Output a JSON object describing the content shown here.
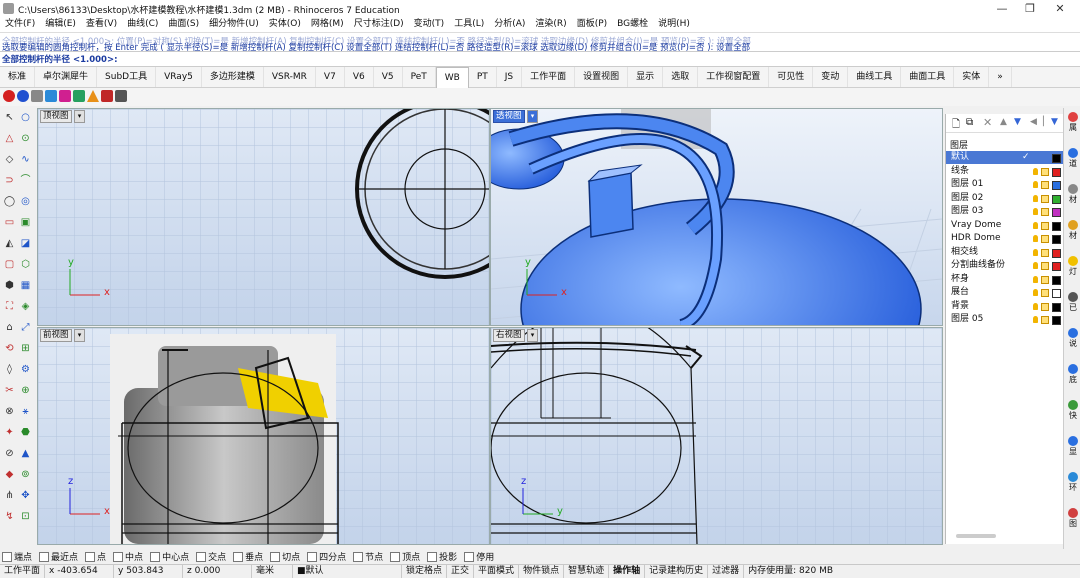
{
  "window": {
    "title": "C:\\Users\\86133\\Desktop\\水杯建模教程\\水杯建模1.3dm (2 MB) - Rhinoceros 7 Education",
    "minimize": "—",
    "maximize": "❐",
    "close": "✕"
  },
  "menu": [
    "文件(F)",
    "编辑(E)",
    "查看(V)",
    "曲线(C)",
    "曲面(S)",
    "细分物件(U)",
    "实体(O)",
    "网格(M)",
    "尺寸标注(D)",
    "变动(T)",
    "工具(L)",
    "分析(A)",
    "渲染(R)",
    "面板(P)",
    "BG螺栓",
    "说明(H)"
  ],
  "command": {
    "history_faded": "全部控制杆的半径 <1.000>: 位置(P)=对称(S) 切换(T)=是 新增控制杆(A) 复制控制杆(C) 设置全部(T) 连结控制杆(L)=否 路径造型(R)=滚球 选取边缘(D) 修剪并组合(I)=是 预览(P)=否 ): 设置全部",
    "history": "选取要编辑的圆角控制杆，按 Enter 完成 ( 显示半径(S)=是  新增控制杆(A)  复制控制杆(C)  设置全部(T)  连结控制杆(L)=否  路径造型(R)=滚球  选取边缘(D)  修剪并组合(I)=是  预览(P)=否 ): 设置全部",
    "prompt": "全部控制杆的半径 <1.000>:"
  },
  "tabs": [
    "标准",
    "卓尔渊犀牛",
    "SubD工具",
    "VRay5",
    "多边形建模",
    "VSR-MR",
    "V7",
    "V6",
    "V5",
    "PeT",
    "WB",
    "PT",
    "JS",
    "工作平面",
    "设置视图",
    "显示",
    "选取",
    "工作视窗配置",
    "可见性",
    "变动",
    "曲线工具",
    "曲面工具",
    "实体"
  ],
  "active_tab": "WB",
  "tab_overflow": "»",
  "viewports": {
    "top": {
      "label": "顶视图",
      "x_axis": "x",
      "y_axis": "y"
    },
    "perspective": {
      "label": "透视图",
      "x_axis": "x",
      "y_axis": "y"
    },
    "front": {
      "label": "前视图",
      "x_axis": "x",
      "z_axis": "z"
    },
    "right": {
      "label": "右视图",
      "x_axis": "y",
      "z_axis": "z"
    }
  },
  "layers": {
    "header": "图层",
    "rows": [
      {
        "name": "默认",
        "selected": true,
        "check": "✓",
        "color": "#000000"
      },
      {
        "name": "线条",
        "color": "#e02020"
      },
      {
        "name": "图层 01",
        "color": "#2a6fe0"
      },
      {
        "name": "图层 02",
        "color": "#30b030"
      },
      {
        "name": "图层 03",
        "color": "#c030c0"
      },
      {
        "name": "Vray Dome",
        "color": "#000000"
      },
      {
        "name": "HDR Dome",
        "color": "#000000"
      },
      {
        "name": "相交线",
        "color": "#e02020"
      },
      {
        "name": "分割曲线备份",
        "color": "#e02020"
      },
      {
        "name": "杯身",
        "color": "#000000"
      },
      {
        "name": "展台",
        "color": "#ffffff"
      },
      {
        "name": "背景",
        "color": "#000000"
      },
      {
        "name": "图层 05",
        "color": "#000000"
      }
    ]
  },
  "right_dock": [
    "属",
    "道",
    "材",
    "材",
    "灯",
    "已",
    "说",
    "底",
    "快",
    "显",
    "环",
    "图"
  ],
  "osnaps": [
    "端点",
    "最近点",
    "点",
    "中点",
    "中心点",
    "交点",
    "垂点",
    "切点",
    "四分点",
    "节点",
    "顶点",
    "投影",
    "停用"
  ],
  "status": {
    "cplane": "工作平面",
    "x": "x -403.654",
    "y": "y 503.843",
    "z": "z 0.000",
    "unit": "毫米",
    "layer": "■默认",
    "items": [
      "锁定格点",
      "正交",
      "平面模式",
      "物件锁点",
      "智慧轨迹",
      "操作轴",
      "记录建构历史",
      "过滤器"
    ],
    "memory": "内存使用量: 820 MB"
  }
}
